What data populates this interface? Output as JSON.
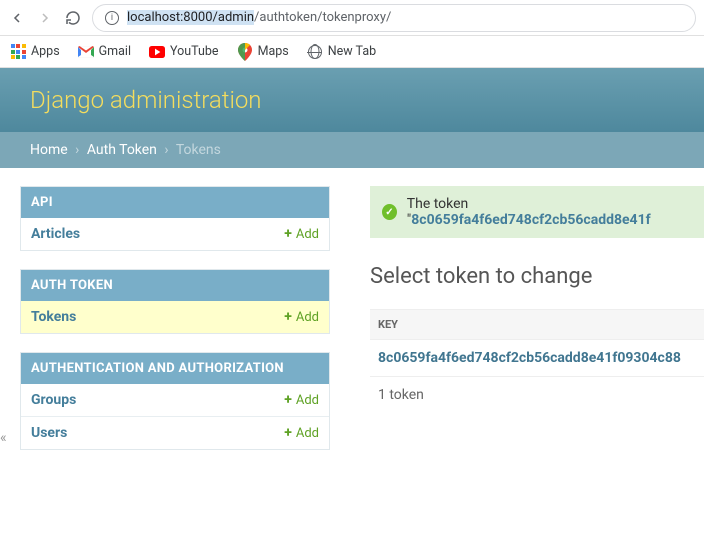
{
  "bookmarks": {
    "apps": "Apps",
    "gmail": "Gmail",
    "youtube": "YouTube",
    "maps": "Maps",
    "newtab": "New Tab"
  },
  "url": {
    "highlighted": "localhost:8000/admin",
    "rest": "/authtoken/tokenproxy/"
  },
  "header": {
    "title": "Django administration"
  },
  "breadcrumbs": {
    "home": "Home",
    "auth_token": "Auth Token",
    "current": "Tokens"
  },
  "sidebar": {
    "api": {
      "caption": "API",
      "items": [
        {
          "label": "Articles",
          "add": "Add"
        }
      ]
    },
    "authtoken": {
      "caption": "AUTH TOKEN",
      "items": [
        {
          "label": "Tokens",
          "add": "Add",
          "highlight": true
        }
      ]
    },
    "auth": {
      "caption": "AUTHENTICATION AND AUTHORIZATION",
      "items": [
        {
          "label": "Groups",
          "add": "Add"
        },
        {
          "label": "Users",
          "add": "Add"
        }
      ]
    }
  },
  "message": {
    "prefix": "The token \"",
    "token": "8c0659fa4f6ed748cf2cb56cadd8e41f"
  },
  "content": {
    "title": "Select token to change",
    "col_key": "KEY",
    "row_key": "8c0659fa4f6ed748cf2cb56cadd8e41f09304c88",
    "count": "1 token"
  }
}
